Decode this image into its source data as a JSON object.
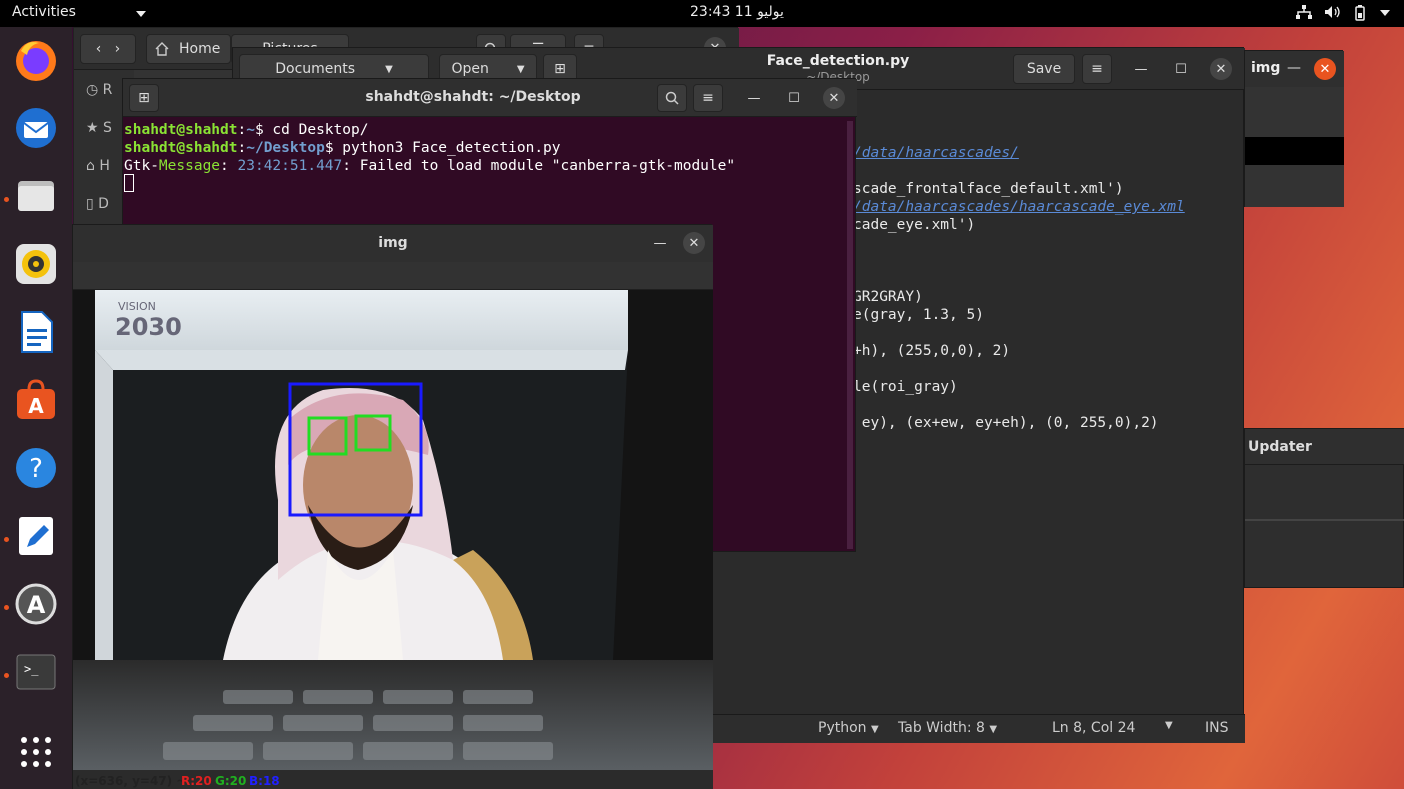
{
  "topbar": {
    "activities": "Activities",
    "clock": "23:43  11 يوليو"
  },
  "files": {
    "home_label": "Home",
    "pictures_label": "Pictures",
    "documents_label": "Documents",
    "open_label": "Open",
    "sidebar_letters": [
      "R",
      "S",
      "H",
      "D"
    ]
  },
  "editor": {
    "title": "Face_detection.py",
    "subtitle": "~/Desktop",
    "save_label": "Save",
    "code_lines": [
      {
        "text": "/data/haarcascades/",
        "kind": "comment"
      },
      {
        "text": "scade_frontalface_default.xml')",
        "kind": "normal"
      },
      {
        "text": "/data/haarcascades/haarcascade_eye.xml",
        "kind": "comment"
      },
      {
        "text": "cade_eye.xml')",
        "kind": "normal"
      },
      {
        "text": "GR2GRAY)",
        "kind": "normal"
      },
      {
        "text": "e(gray, 1.3, 5)",
        "kind": "normal"
      },
      {
        "text": "+h), (255,0,0), 2)",
        "kind": "normal"
      },
      {
        "text": "le(roi_gray)",
        "kind": "normal"
      },
      {
        "text": " ey), (ex+ew, ey+eh), (0, 255,0),2)",
        "kind": "normal"
      }
    ],
    "status": {
      "language": "Python",
      "tab_width": "Tab Width: 8",
      "position": "Ln 8, Col 24",
      "mode": "INS"
    }
  },
  "imgwin": {
    "title": "img"
  },
  "updater": {
    "title": "Updater"
  },
  "terminal": {
    "title": "shahdt@shahdt: ~/Desktop",
    "lines": [
      {
        "user": "shahdt@shahdt",
        "path": "~",
        "cmd": "$ cd Desktop/"
      },
      {
        "user": "shahdt@shahdt",
        "path": "~/Desktop",
        "cmd": "$ python3 Face_detection.py"
      }
    ],
    "message": {
      "prefix": "Gtk-",
      "tag": "Message",
      "time": "23:42:51.447",
      "text": ": Failed to load module \"canberra-gtk-module\""
    }
  },
  "cv": {
    "title": "img",
    "coords": "(x=636, y=47) ~",
    "r": "R:20",
    "g": "G:20",
    "b": "B:18",
    "face_color": "#1a1aff",
    "eye_color": "#22dd22"
  },
  "colors": {
    "prompt_user": "#8ae234",
    "prompt_path": "#729fcf",
    "terminal_bg": "#300a24",
    "accent": "#e95420"
  }
}
